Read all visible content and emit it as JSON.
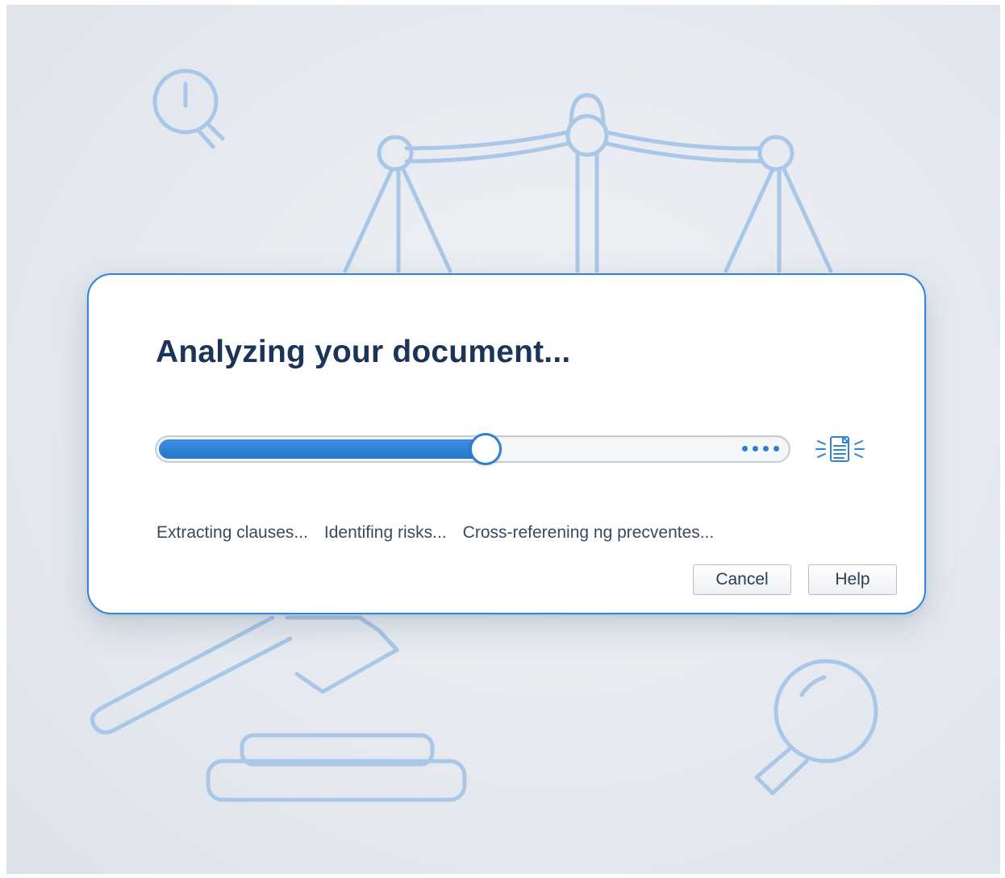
{
  "dialog": {
    "title": "Analyzing your document...",
    "progress": {
      "fraction": 0.52
    },
    "steps": [
      "Extracting clauses...",
      "Identifing risks...",
      "Cross-referening ng precventes..."
    ],
    "buttons": {
      "cancel_label": "Cancel",
      "help_label": "Help"
    },
    "doc_icon": "document-scan-icon"
  },
  "background": {
    "icons": [
      "clock-icon",
      "scales-of-justice-icon",
      "gavel-icon",
      "magnifying-glass-icon"
    ]
  },
  "colors": {
    "accent": "#2f84d6",
    "title": "#1b3458",
    "text": "#394a60",
    "background_line_art": "#a9c7e8"
  }
}
